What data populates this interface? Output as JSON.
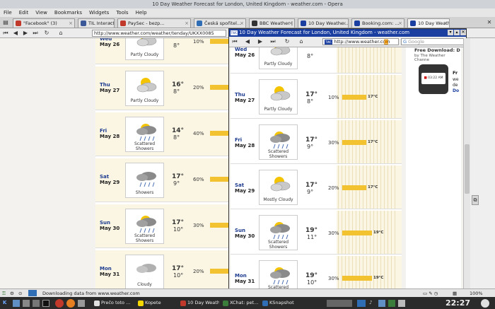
{
  "window": {
    "title": "10 Day Weather Forecast for London, United Kingdom - weather.com - Opera"
  },
  "menu": [
    "File",
    "Edit",
    "View",
    "Bookmarks",
    "Widgets",
    "Tools",
    "Help"
  ],
  "tabs": [
    {
      "label": "\"Facebook\" (3)",
      "color": "#c0392b"
    },
    {
      "label": "TIL Interactive ...",
      "color": "#3b5998"
    },
    {
      "label": "PaySec - bezp...",
      "color": "#c0392b"
    },
    {
      "label": "Česká spořitel...",
      "color": "#2f6db5"
    },
    {
      "label": "BBC Weather | ...",
      "color": "#333333"
    },
    {
      "label": "10 Day Weathe...",
      "color": "#1a3fa0"
    },
    {
      "label": "Booking.com: ...",
      "color": "#1a3fa0"
    },
    {
      "label": "10 Day Weath...",
      "color": "#1a3fa0"
    }
  ],
  "main_url": "http://www.weather.com/weather/tenday/UKXX0085",
  "popup": {
    "title": "10 Day Weather Forecast for London, United Kingdom - weather.com",
    "icon_text": "TWC",
    "url": "http://www.weather.com",
    "search_placeholder": "Google"
  },
  "sidebar": {
    "title": "Free Download: D",
    "by_line": "by The Weather Channe",
    "fr": "Fr",
    "we": "we",
    "de": "de",
    "do": "Do",
    "clock": "03:22 AM"
  },
  "left_days": [
    {
      "day": "Wed",
      "date": "May 26",
      "cond": "Partly Cloudy",
      "hi": "",
      "lo": "8°",
      "pct": "10%"
    },
    {
      "day": "Thu",
      "date": "May 27",
      "cond": "Partly Cloudy",
      "hi": "16°",
      "lo": "8°",
      "pct": "20%"
    },
    {
      "day": "Fri",
      "date": "May 28",
      "cond": "Scattered Showers",
      "hi": "14°",
      "lo": "8°",
      "pct": "40%"
    },
    {
      "day": "Sat",
      "date": "May 29",
      "cond": "Showers",
      "hi": "17°",
      "lo": "9°",
      "pct": "60%"
    },
    {
      "day": "Sun",
      "date": "May 30",
      "cond": "Scattered Showers",
      "hi": "17°",
      "lo": "10°",
      "pct": "30%"
    },
    {
      "day": "Mon",
      "date": "May 31",
      "cond": "Cloudy",
      "hi": "17°",
      "lo": "10°",
      "pct": "20%"
    }
  ],
  "popup_days": [
    {
      "day": "Wed",
      "date": "May 26",
      "cond": "Partly Cloudy",
      "hi": "",
      "lo": "8°",
      "pct": "",
      "bar": ""
    },
    {
      "day": "Thu",
      "date": "May 27",
      "cond": "Partly Cloudy",
      "hi": "17°",
      "lo": "8°",
      "pct": "10%",
      "bar": "17°C"
    },
    {
      "day": "Fri",
      "date": "May 28",
      "cond": "Scattered Showers",
      "hi": "17°",
      "lo": "9°",
      "pct": "30%",
      "bar": "17°C"
    },
    {
      "day": "Sat",
      "date": "May 29",
      "cond": "Mostly Cloudy",
      "hi": "17°",
      "lo": "9°",
      "pct": "20%",
      "bar": "17°C"
    },
    {
      "day": "Sun",
      "date": "May 30",
      "cond": "Scattered Showers",
      "hi": "19°",
      "lo": "11°",
      "pct": "30%",
      "bar": "19°C"
    },
    {
      "day": "Mon",
      "date": "May 31",
      "cond": "Scattered Showers",
      "hi": "19°",
      "lo": "10°",
      "pct": "30%",
      "bar": "19°C"
    }
  ],
  "status": {
    "text": "Downloading data from www.weather.com",
    "zoom": "100%"
  },
  "taskbar": {
    "items": [
      {
        "label": "Prečo toto ...",
        "color": "#e0e0e0"
      },
      {
        "label": "Kopete",
        "color": "#f5d800"
      },
      {
        "label": "10 Day Weath...",
        "color": "#c0392b"
      },
      {
        "label": "XChat: pet...",
        "color": "#3b7d3b"
      },
      {
        "label": "KSnapshot",
        "color": "#2f6db5"
      }
    ],
    "clock": "22:27"
  }
}
